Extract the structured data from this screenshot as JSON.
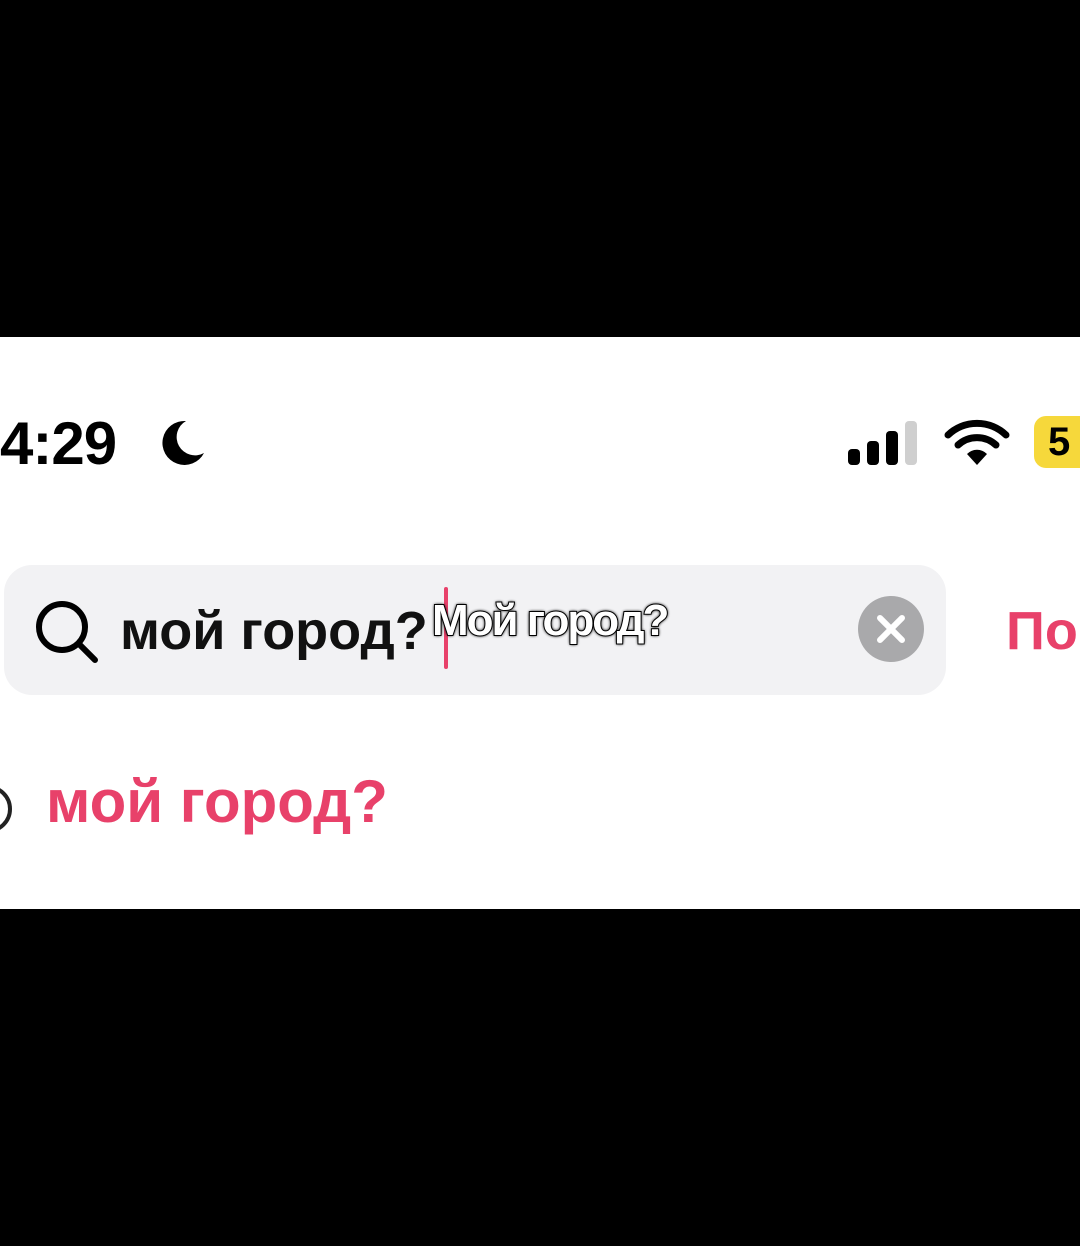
{
  "status_bar": {
    "time": "4:29",
    "battery_level": "5",
    "icons": [
      "moon-icon",
      "cellular-signal-icon",
      "wifi-icon",
      "battery-icon"
    ]
  },
  "search": {
    "value": "мой город?",
    "overlay_caption": "Мой город?",
    "clear_icon": "close-icon",
    "cancel_label": "По"
  },
  "suggestions": [
    {
      "label": "мой город?"
    }
  ],
  "colors": {
    "accent": "#e8416a",
    "search_bg": "#f2f2f4",
    "battery_bg": "#f6d83b",
    "clear_bg": "#a9a9ab"
  }
}
